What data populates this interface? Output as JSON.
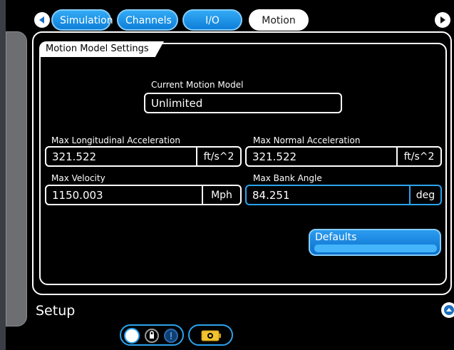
{
  "nav": {
    "tabs": [
      {
        "label": "Simulation",
        "state": "inactive"
      },
      {
        "label": "Channels",
        "state": "inactive"
      },
      {
        "label": "I/O",
        "state": "inactive"
      },
      {
        "label": "Motion",
        "state": "active"
      }
    ],
    "prev_icon": "arrow-left-icon",
    "next_icon": "arrow-right-icon"
  },
  "panel": {
    "section_title": "Motion Model Settings",
    "current_model": {
      "label": "Current Motion Model",
      "value": "Unlimited"
    },
    "max_longitudinal_acceleration": {
      "label": "Max Longitudinal Acceleration",
      "value": "321.522",
      "unit": "ft/s^2"
    },
    "max_normal_acceleration": {
      "label": "Max Normal Acceleration",
      "value": "321.522",
      "unit": "ft/s^2"
    },
    "max_velocity": {
      "label": "Max Velocity",
      "value": "1150.003",
      "unit": "Mph"
    },
    "max_bank_angle": {
      "label": "Max Bank Angle",
      "value": "84.251",
      "unit": "deg"
    },
    "defaults_button": "Defaults"
  },
  "footer": {
    "title": "Setup",
    "collapse_icon": "chevron-up-icon",
    "toggle_icons": [
      "circle-toggle-icon",
      "lock-icon",
      "info-icon"
    ],
    "battery_icon": "battery-icon"
  },
  "colors": {
    "accent_blue": "#1a8ee6",
    "highlight_border": "#2aa3ee",
    "background": "#000000",
    "rail_gray": "#6c6e72"
  }
}
